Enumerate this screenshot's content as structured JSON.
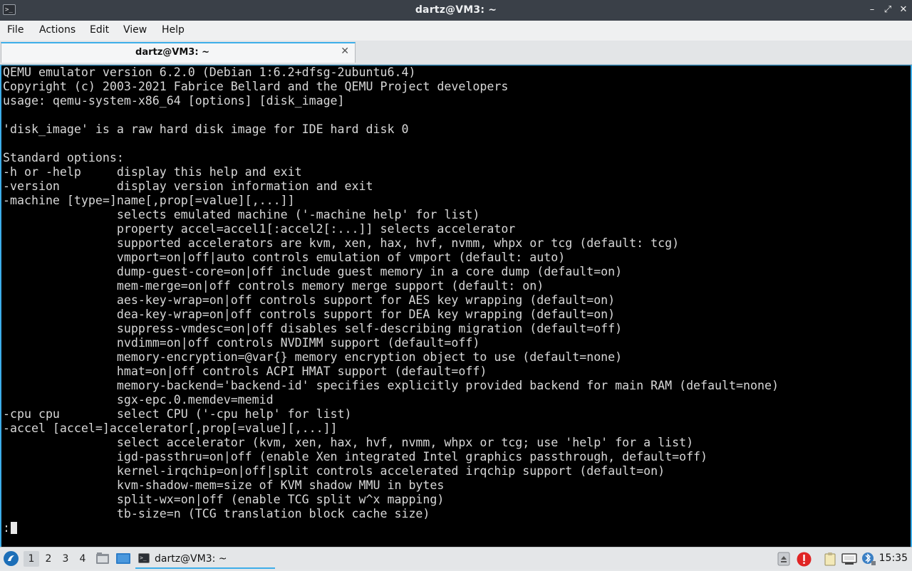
{
  "window": {
    "title": "dartz@VM3: ~",
    "app_icon": ">_",
    "controls": {
      "minimize": "–",
      "restore": "⤢",
      "close": "✕"
    }
  },
  "menu": [
    "File",
    "Actions",
    "Edit",
    "View",
    "Help"
  ],
  "tabs": [
    {
      "label": "dartz@VM3: ~",
      "close": "✕",
      "active": true
    }
  ],
  "terminal": {
    "lines": [
      "QEMU emulator version 6.2.0 (Debian 1:6.2+dfsg-2ubuntu6.4)",
      "Copyright (c) 2003-2021 Fabrice Bellard and the QEMU Project developers",
      "usage: qemu-system-x86_64 [options] [disk_image]",
      "",
      "'disk_image' is a raw hard disk image for IDE hard disk 0",
      "",
      "Standard options:",
      "-h or -help     display this help and exit",
      "-version        display version information and exit",
      "-machine [type=]name[,prop[=value][,...]]",
      "                selects emulated machine ('-machine help' for list)",
      "                property accel=accel1[:accel2[:...]] selects accelerator",
      "                supported accelerators are kvm, xen, hax, hvf, nvmm, whpx or tcg (default: tcg)",
      "                vmport=on|off|auto controls emulation of vmport (default: auto)",
      "                dump-guest-core=on|off include guest memory in a core dump (default=on)",
      "                mem-merge=on|off controls memory merge support (default: on)",
      "                aes-key-wrap=on|off controls support for AES key wrapping (default=on)",
      "                dea-key-wrap=on|off controls support for DEA key wrapping (default=on)",
      "                suppress-vmdesc=on|off disables self-describing migration (default=off)",
      "                nvdimm=on|off controls NVDIMM support (default=off)",
      "                memory-encryption=@var{} memory encryption object to use (default=none)",
      "                hmat=on|off controls ACPI HMAT support (default=off)",
      "                memory-backend='backend-id' specifies explicitly provided backend for main RAM (default=none)",
      "                sgx-epc.0.memdev=memid",
      "-cpu cpu        select CPU ('-cpu help' for list)",
      "-accel [accel=]accelerator[,prop[=value][,...]]",
      "                select accelerator (kvm, xen, hax, hvf, nvmm, whpx or tcg; use 'help' for a list)",
      "                igd-passthru=on|off (enable Xen integrated Intel graphics passthrough, default=off)",
      "                kernel-irqchip=on|off|split controls accelerated irqchip support (default=on)",
      "                kvm-shadow-mem=size of KVM shadow MMU in bytes",
      "                split-wx=on|off (enable TCG split w^x mapping)",
      "                tb-size=n (TCG translation block cache size)"
    ],
    "prompt": ":"
  },
  "taskbar": {
    "start_icon": "start-menu-icon",
    "workspaces": [
      "1",
      "2",
      "3",
      "4"
    ],
    "active_workspace": "1",
    "quick_launch": [
      "file-manager-icon",
      "show-desktop-icon"
    ],
    "task": {
      "label": "dartz@VM3: ~",
      "icon": "terminal-icon"
    },
    "tray": [
      "eject-icon",
      "update-alert-icon",
      "clipboard-icon",
      "network-icon",
      "bluetooth-icon"
    ],
    "clock": "15:35"
  },
  "colors": {
    "accent": "#3daee9",
    "titlebar": "#3a4048",
    "terminal_bg": "#000000",
    "terminal_fg": "#d8d8d8",
    "alert": "#e02424"
  }
}
